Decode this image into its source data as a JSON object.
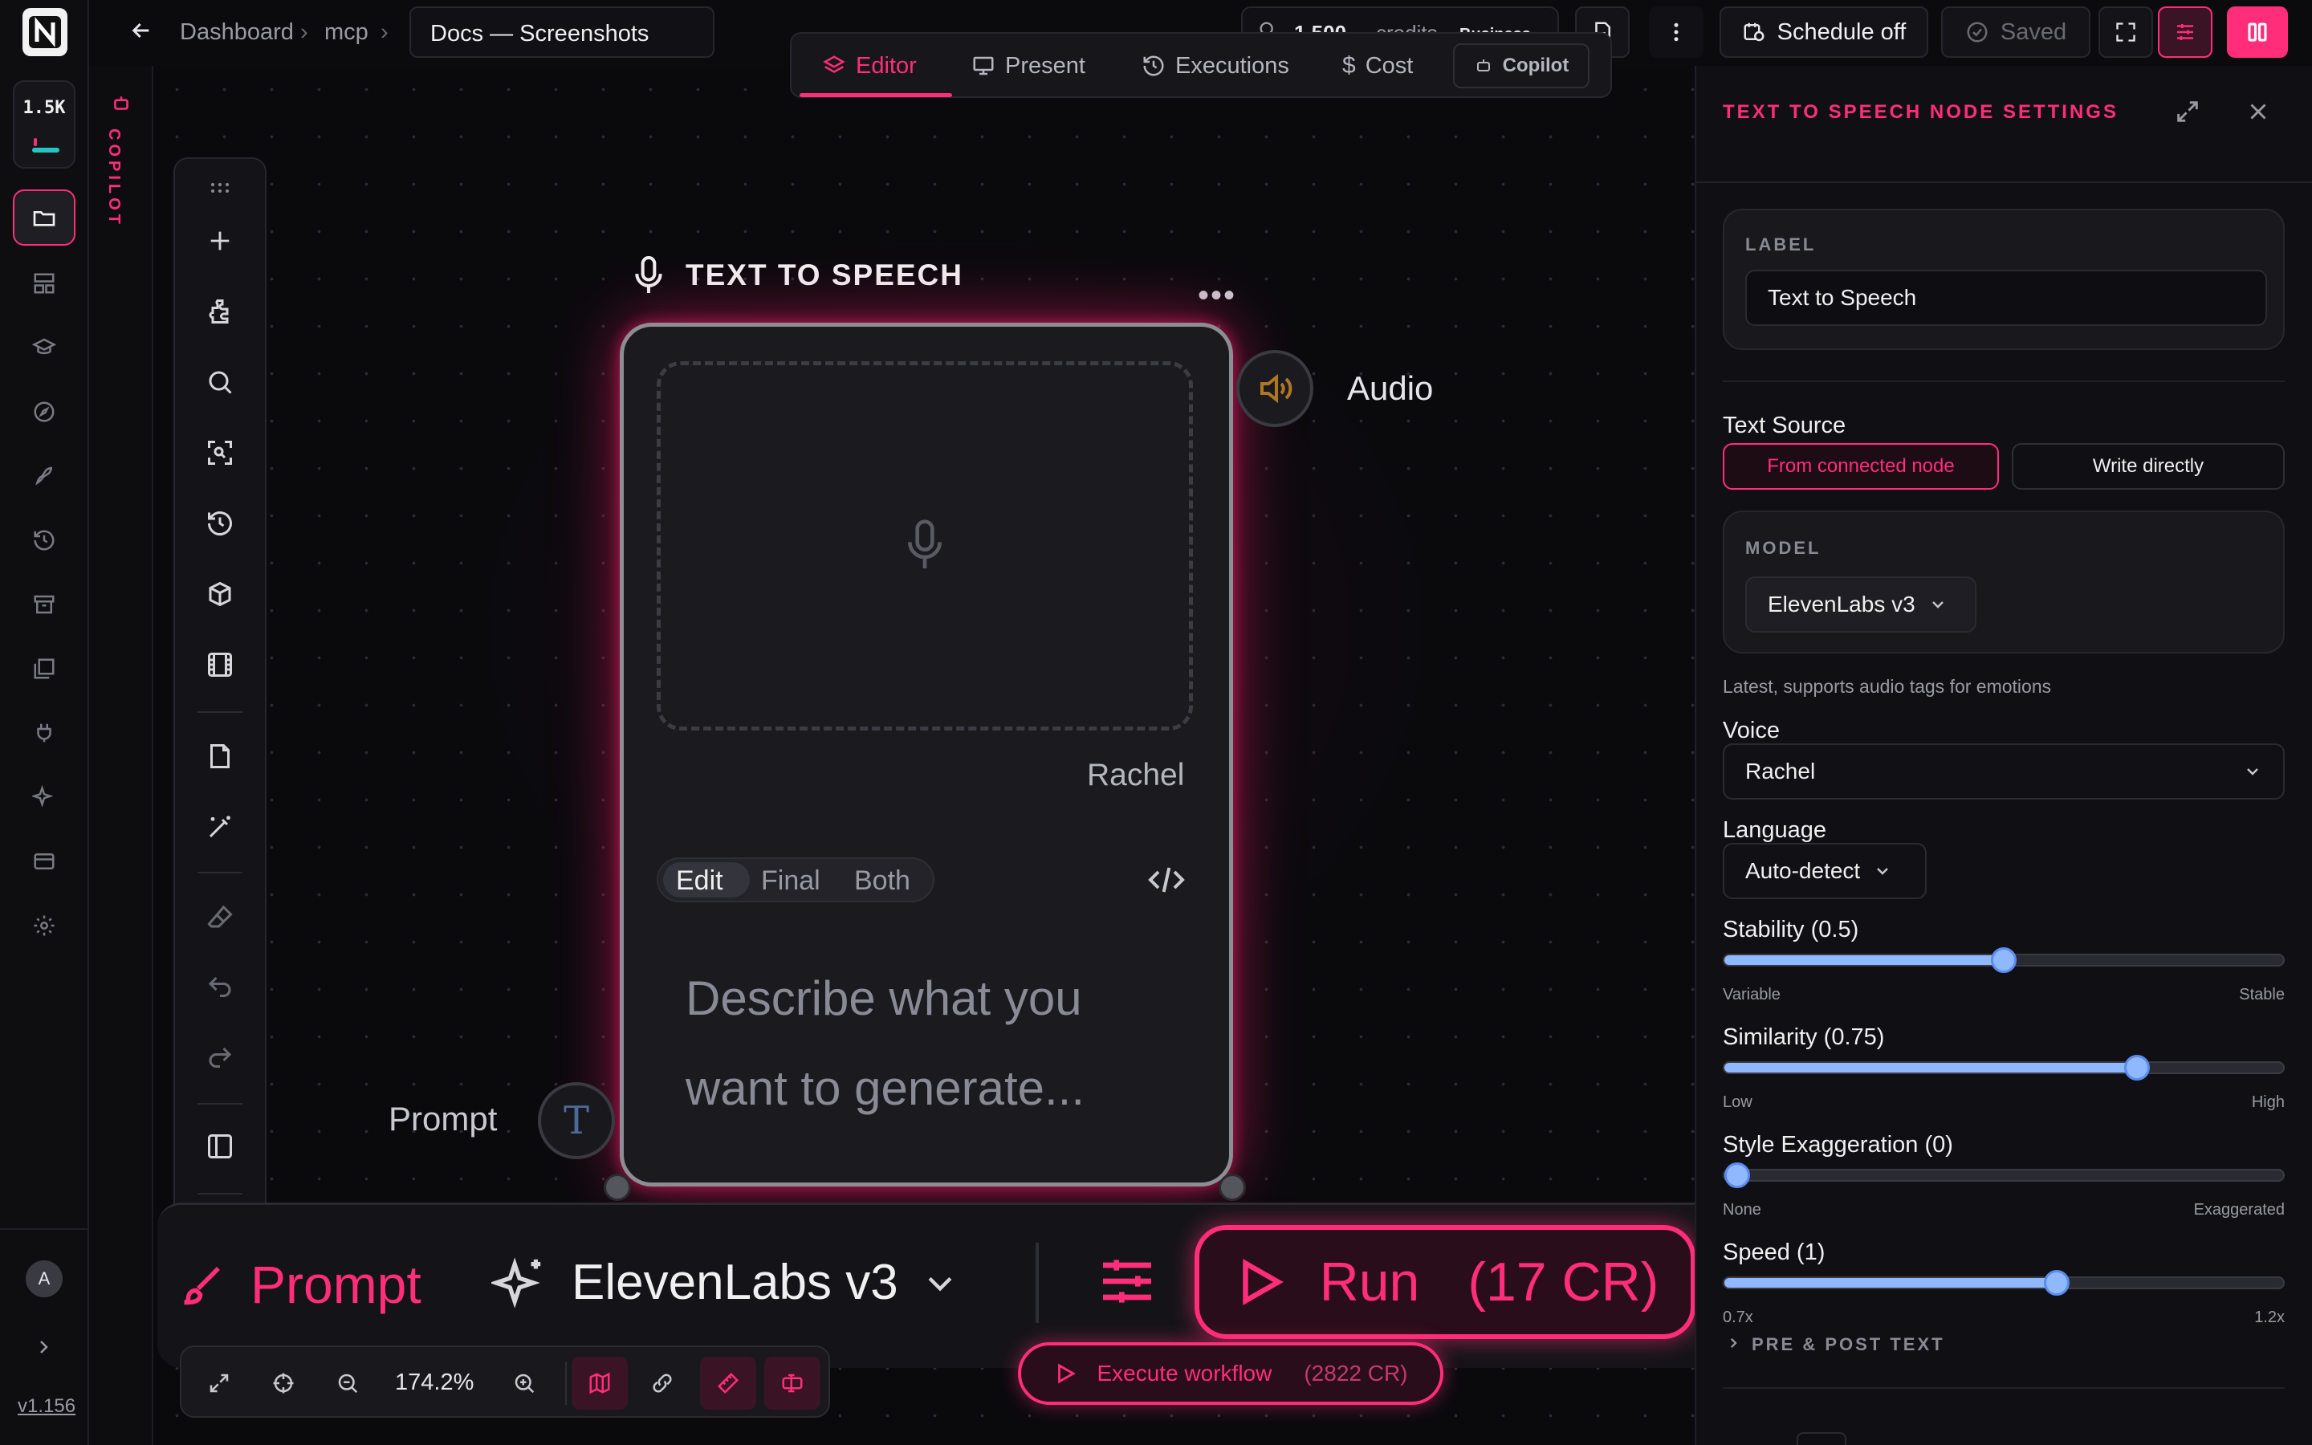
{
  "rail": {
    "credits": "1.5K",
    "avatar_initial": "A",
    "version": "v1.156"
  },
  "copilot_strip": {
    "label": "COPILOT"
  },
  "topbar": {
    "breadcrumb": [
      "Dashboard",
      "mcp"
    ],
    "doc_title": "Docs — Screenshots",
    "credits_amount": "1,500",
    "credits_word": "credits",
    "plan": "Business",
    "schedule_label": "Schedule off",
    "saved_label": "Saved"
  },
  "mode_tabs": [
    {
      "label": "Editor",
      "active": true
    },
    {
      "label": "Present"
    },
    {
      "label": "Executions"
    },
    {
      "label": "Cost"
    },
    {
      "label": "Copilot"
    }
  ],
  "node": {
    "title": "TEXT TO SPEECH",
    "voice": "Rachel",
    "view_modes": [
      "Edit",
      "Final",
      "Both"
    ],
    "active_view": "Edit",
    "prompt_placeholder": "Describe what you want to generate...",
    "output_label": "Audio",
    "input_label": "Prompt",
    "input_glyph": "T"
  },
  "prompt_bar": {
    "prompt_label": "Prompt",
    "model": "ElevenLabs v3",
    "run_label": "Run",
    "run_cost": "(17 CR)"
  },
  "zoom_bar": {
    "zoom": "174.2%"
  },
  "execute": {
    "label": "Execute workflow",
    "cost": "(2822 CR)"
  },
  "panel": {
    "title": "TEXT TO SPEECH NODE SETTINGS",
    "label_caption": "LABEL",
    "label_value": "Text to Speech",
    "text_source_label": "Text Source",
    "text_source_options": [
      "From connected node",
      "Write directly"
    ],
    "model_caption": "MODEL",
    "model_value": "ElevenLabs v3",
    "model_hint": "Latest, supports audio tags for emotions",
    "voice_label": "Voice",
    "voice_value": "Rachel",
    "language_label": "Language",
    "language_value": "Auto-detect",
    "sliders": [
      {
        "label": "Stability (0.5)",
        "value": 0.5,
        "min_label": "Variable",
        "max_label": "Stable"
      },
      {
        "label": "Similarity (0.75)",
        "value": 0.75,
        "min_label": "Low",
        "max_label": "High"
      },
      {
        "label": "Style Exaggeration (0)",
        "value": 0.0,
        "min_label": "None",
        "max_label": "Exaggerated"
      },
      {
        "label": "Speed (1)",
        "value": 0.6,
        "min_label": "0.7x",
        "max_label": "1.2x"
      }
    ],
    "pre_post_label": "PRE & POST TEXT"
  },
  "colors": {
    "accent": "#ff2d7a",
    "slider": "#8fb8ff",
    "background": "#0b0b0e"
  }
}
